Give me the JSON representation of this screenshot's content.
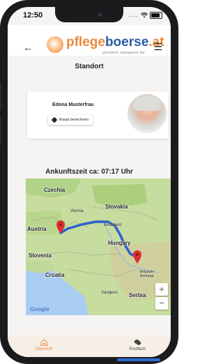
{
  "status_bar": {
    "time": "12:50",
    "dots": "....",
    "wifi": "wifi-icon",
    "battery": "battery-icon"
  },
  "header": {
    "back_icon": "arrow-left-icon",
    "logo_part1": "pflege",
    "logo_part2": "boerse",
    "logo_part3": ".at",
    "tagline": "persönlich. transparent. fair.",
    "menu_icon": "hamburger-menu-icon"
  },
  "page": {
    "title": "Standort"
  },
  "card": {
    "name": "Edona Musterfrau",
    "route_button_label": "Route berechnen",
    "route_icon": "directions-icon"
  },
  "arrival": {
    "label": "Ankunftszeit ca: 07:17 Uhr"
  },
  "map": {
    "countries": [
      "Czechia",
      "Slovakia",
      "Austria",
      "Hungary",
      "Slovenia",
      "Croatia",
      "Serbia"
    ],
    "cities": [
      "Vienna",
      "Budapest",
      "Belgrade Београд",
      "Sarajevo"
    ],
    "zoom_in": "+",
    "zoom_out": "−",
    "attribution": "Google",
    "colors": {
      "land": "#c9dfa0",
      "water": "#a9cdf2",
      "route": "#2a5fcf",
      "marker": "#d9302b"
    }
  },
  "tabbar": {
    "tab_overview": {
      "label": "Übersicht",
      "icon": "home-icon",
      "color": "#ea8a3c"
    },
    "tab_inbox": {
      "label": "Postfach",
      "icon": "chat-bubbles-icon",
      "color": "#444444"
    }
  }
}
